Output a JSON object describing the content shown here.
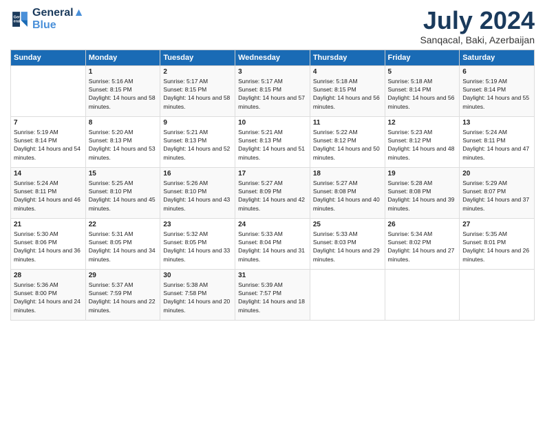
{
  "logo": {
    "line1": "General",
    "line2": "Blue"
  },
  "title": "July 2024",
  "location": "Sanqacal, Baki, Azerbaijan",
  "headers": [
    "Sunday",
    "Monday",
    "Tuesday",
    "Wednesday",
    "Thursday",
    "Friday",
    "Saturday"
  ],
  "weeks": [
    [
      {
        "day": "",
        "sunrise": "",
        "sunset": "",
        "daylight": ""
      },
      {
        "day": "1",
        "sunrise": "Sunrise: 5:16 AM",
        "sunset": "Sunset: 8:15 PM",
        "daylight": "Daylight: 14 hours and 58 minutes."
      },
      {
        "day": "2",
        "sunrise": "Sunrise: 5:17 AM",
        "sunset": "Sunset: 8:15 PM",
        "daylight": "Daylight: 14 hours and 58 minutes."
      },
      {
        "day": "3",
        "sunrise": "Sunrise: 5:17 AM",
        "sunset": "Sunset: 8:15 PM",
        "daylight": "Daylight: 14 hours and 57 minutes."
      },
      {
        "day": "4",
        "sunrise": "Sunrise: 5:18 AM",
        "sunset": "Sunset: 8:15 PM",
        "daylight": "Daylight: 14 hours and 56 minutes."
      },
      {
        "day": "5",
        "sunrise": "Sunrise: 5:18 AM",
        "sunset": "Sunset: 8:14 PM",
        "daylight": "Daylight: 14 hours and 56 minutes."
      },
      {
        "day": "6",
        "sunrise": "Sunrise: 5:19 AM",
        "sunset": "Sunset: 8:14 PM",
        "daylight": "Daylight: 14 hours and 55 minutes."
      }
    ],
    [
      {
        "day": "7",
        "sunrise": "Sunrise: 5:19 AM",
        "sunset": "Sunset: 8:14 PM",
        "daylight": "Daylight: 14 hours and 54 minutes."
      },
      {
        "day": "8",
        "sunrise": "Sunrise: 5:20 AM",
        "sunset": "Sunset: 8:13 PM",
        "daylight": "Daylight: 14 hours and 53 minutes."
      },
      {
        "day": "9",
        "sunrise": "Sunrise: 5:21 AM",
        "sunset": "Sunset: 8:13 PM",
        "daylight": "Daylight: 14 hours and 52 minutes."
      },
      {
        "day": "10",
        "sunrise": "Sunrise: 5:21 AM",
        "sunset": "Sunset: 8:13 PM",
        "daylight": "Daylight: 14 hours and 51 minutes."
      },
      {
        "day": "11",
        "sunrise": "Sunrise: 5:22 AM",
        "sunset": "Sunset: 8:12 PM",
        "daylight": "Daylight: 14 hours and 50 minutes."
      },
      {
        "day": "12",
        "sunrise": "Sunrise: 5:23 AM",
        "sunset": "Sunset: 8:12 PM",
        "daylight": "Daylight: 14 hours and 48 minutes."
      },
      {
        "day": "13",
        "sunrise": "Sunrise: 5:24 AM",
        "sunset": "Sunset: 8:11 PM",
        "daylight": "Daylight: 14 hours and 47 minutes."
      }
    ],
    [
      {
        "day": "14",
        "sunrise": "Sunrise: 5:24 AM",
        "sunset": "Sunset: 8:11 PM",
        "daylight": "Daylight: 14 hours and 46 minutes."
      },
      {
        "day": "15",
        "sunrise": "Sunrise: 5:25 AM",
        "sunset": "Sunset: 8:10 PM",
        "daylight": "Daylight: 14 hours and 45 minutes."
      },
      {
        "day": "16",
        "sunrise": "Sunrise: 5:26 AM",
        "sunset": "Sunset: 8:10 PM",
        "daylight": "Daylight: 14 hours and 43 minutes."
      },
      {
        "day": "17",
        "sunrise": "Sunrise: 5:27 AM",
        "sunset": "Sunset: 8:09 PM",
        "daylight": "Daylight: 14 hours and 42 minutes."
      },
      {
        "day": "18",
        "sunrise": "Sunrise: 5:27 AM",
        "sunset": "Sunset: 8:08 PM",
        "daylight": "Daylight: 14 hours and 40 minutes."
      },
      {
        "day": "19",
        "sunrise": "Sunrise: 5:28 AM",
        "sunset": "Sunset: 8:08 PM",
        "daylight": "Daylight: 14 hours and 39 minutes."
      },
      {
        "day": "20",
        "sunrise": "Sunrise: 5:29 AM",
        "sunset": "Sunset: 8:07 PM",
        "daylight": "Daylight: 14 hours and 37 minutes."
      }
    ],
    [
      {
        "day": "21",
        "sunrise": "Sunrise: 5:30 AM",
        "sunset": "Sunset: 8:06 PM",
        "daylight": "Daylight: 14 hours and 36 minutes."
      },
      {
        "day": "22",
        "sunrise": "Sunrise: 5:31 AM",
        "sunset": "Sunset: 8:05 PM",
        "daylight": "Daylight: 14 hours and 34 minutes."
      },
      {
        "day": "23",
        "sunrise": "Sunrise: 5:32 AM",
        "sunset": "Sunset: 8:05 PM",
        "daylight": "Daylight: 14 hours and 33 minutes."
      },
      {
        "day": "24",
        "sunrise": "Sunrise: 5:33 AM",
        "sunset": "Sunset: 8:04 PM",
        "daylight": "Daylight: 14 hours and 31 minutes."
      },
      {
        "day": "25",
        "sunrise": "Sunrise: 5:33 AM",
        "sunset": "Sunset: 8:03 PM",
        "daylight": "Daylight: 14 hours and 29 minutes."
      },
      {
        "day": "26",
        "sunrise": "Sunrise: 5:34 AM",
        "sunset": "Sunset: 8:02 PM",
        "daylight": "Daylight: 14 hours and 27 minutes."
      },
      {
        "day": "27",
        "sunrise": "Sunrise: 5:35 AM",
        "sunset": "Sunset: 8:01 PM",
        "daylight": "Daylight: 14 hours and 26 minutes."
      }
    ],
    [
      {
        "day": "28",
        "sunrise": "Sunrise: 5:36 AM",
        "sunset": "Sunset: 8:00 PM",
        "daylight": "Daylight: 14 hours and 24 minutes."
      },
      {
        "day": "29",
        "sunrise": "Sunrise: 5:37 AM",
        "sunset": "Sunset: 7:59 PM",
        "daylight": "Daylight: 14 hours and 22 minutes."
      },
      {
        "day": "30",
        "sunrise": "Sunrise: 5:38 AM",
        "sunset": "Sunset: 7:58 PM",
        "daylight": "Daylight: 14 hours and 20 minutes."
      },
      {
        "day": "31",
        "sunrise": "Sunrise: 5:39 AM",
        "sunset": "Sunset: 7:57 PM",
        "daylight": "Daylight: 14 hours and 18 minutes."
      },
      {
        "day": "",
        "sunrise": "",
        "sunset": "",
        "daylight": ""
      },
      {
        "day": "",
        "sunrise": "",
        "sunset": "",
        "daylight": ""
      },
      {
        "day": "",
        "sunrise": "",
        "sunset": "",
        "daylight": ""
      }
    ]
  ]
}
